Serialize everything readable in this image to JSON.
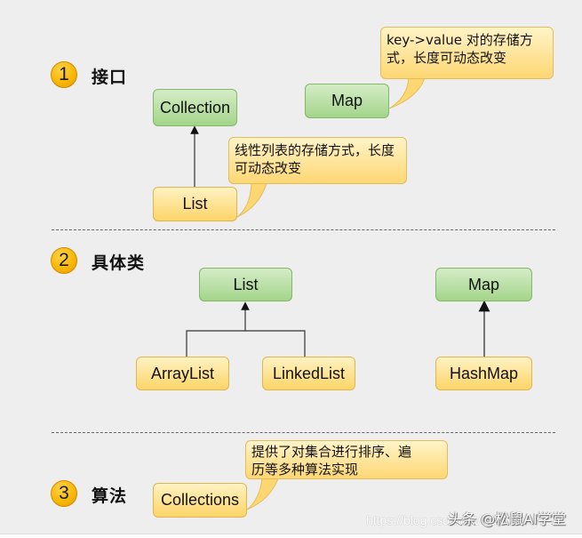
{
  "sections": [
    {
      "number": "1",
      "title": "接口"
    },
    {
      "number": "2",
      "title": "具体类"
    },
    {
      "number": "3",
      "title": "算法"
    }
  ],
  "interfaces": {
    "collection": "Collection",
    "list": "List",
    "map": "Map",
    "map_note": "key->value 对的存储方\n式，长度可动态改变",
    "list_note": "线性列表的存储方式，长度\n可动态改变"
  },
  "classes": {
    "list": "List",
    "array_list": "ArrayList",
    "linked_list": "LinkedList",
    "map": "Map",
    "hash_map": "HashMap"
  },
  "algorithms": {
    "collections": "Collections",
    "collections_note": "提供了对集合进行排序、遍\n历等多种算法实现"
  },
  "watermark": {
    "url": "https://blog.csdn.net/wuzhidaxy",
    "credit": "头条 @松鼠AI学堂"
  },
  "colors": {
    "interface_fill": "#a3d58a",
    "class_fill": "#fdd568",
    "badge": "#f7b500",
    "background": "#eeeeee"
  }
}
